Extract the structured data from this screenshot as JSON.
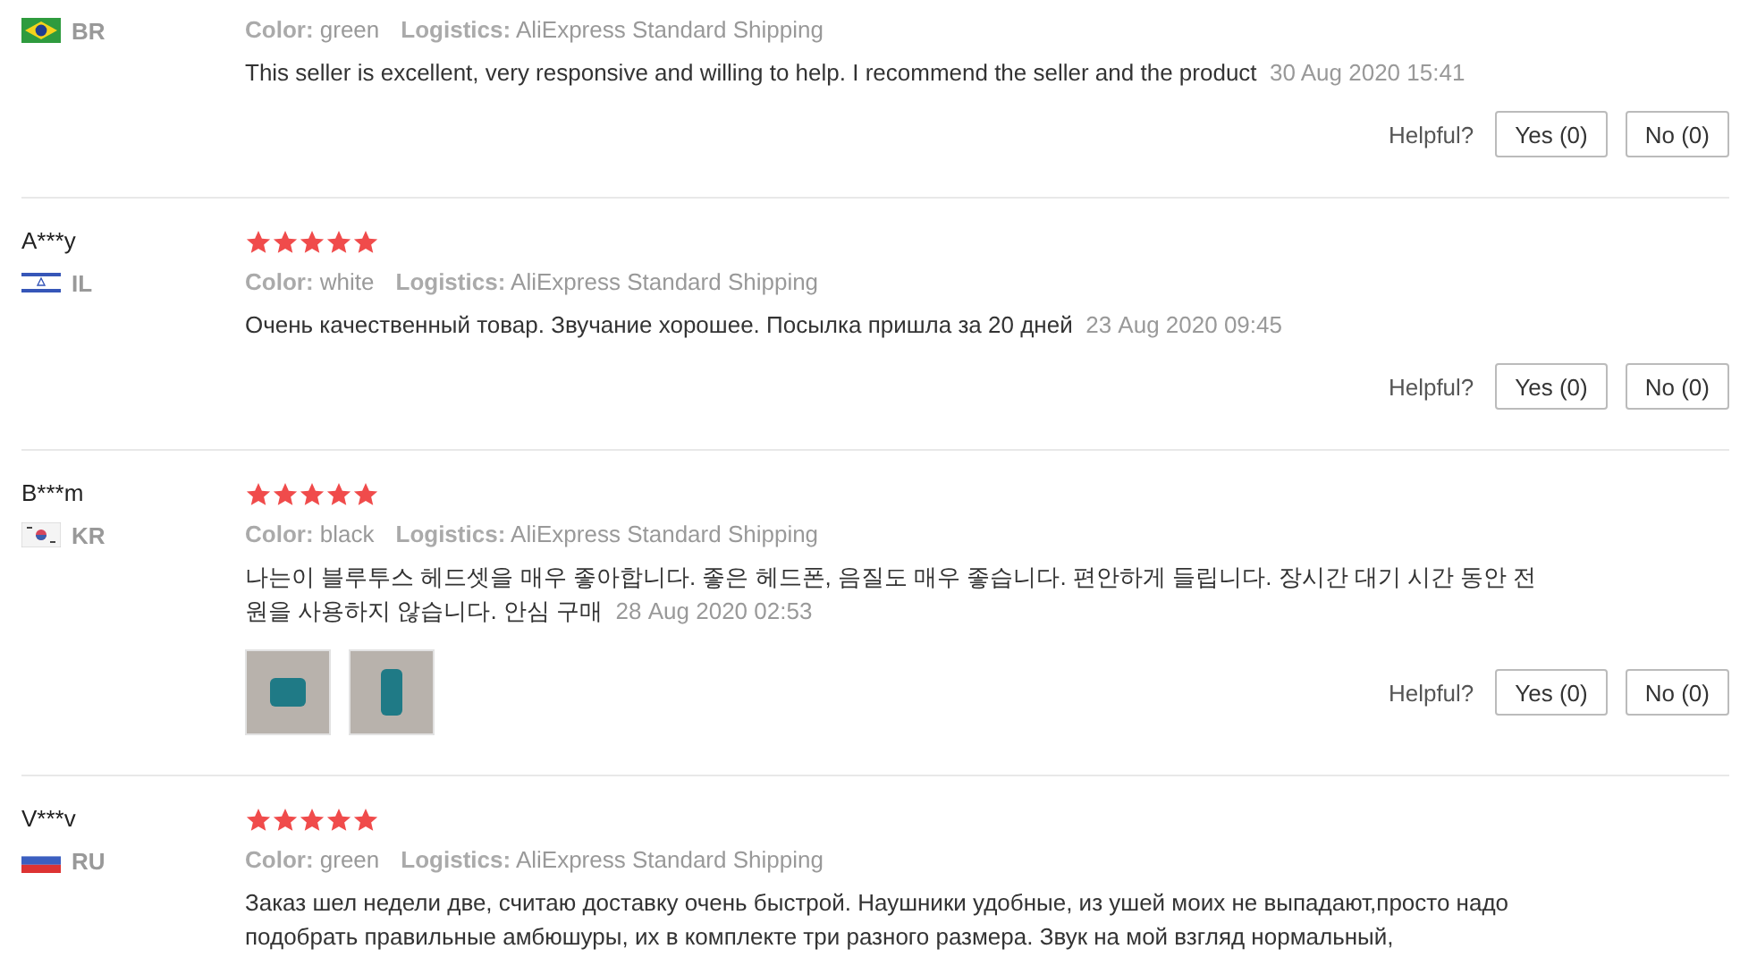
{
  "reviews": [
    {
      "kind": "brazil",
      "country": "BR",
      "color_label": "Color:",
      "color_value": "green",
      "logistics_label": "Logistics:",
      "logistics": "AliExpress Standard Shipping",
      "text": "This seller is excellent, very responsive and willing to help. I recommend the seller and the product",
      "date": "30 Aug 2020 15:41",
      "helpful_label": "Helpful?",
      "yes": "Yes (0)",
      "no": "No (0)"
    },
    {
      "name": "A***y",
      "kind": "israel",
      "country": "IL",
      "stars": 5,
      "color_label": "Color:",
      "color_value": "white",
      "logistics_label": "Logistics:",
      "logistics": "AliExpress Standard Shipping",
      "text": "Очень качественный товар. Звучание хорошее. Посылка пришла за 20 дней",
      "date": "23 Aug 2020 09:45",
      "helpful_label": "Helpful?",
      "yes": "Yes (0)",
      "no": "No (0)"
    },
    {
      "name": "B***m",
      "kind": "korea",
      "country": "KR",
      "stars": 5,
      "color_label": "Color:",
      "color_value": "black",
      "logistics_label": "Logistics:",
      "logistics": "AliExpress Standard Shipping",
      "text": "나는이 블루투스 헤드셋을 매우 좋아합니다. 좋은 헤드폰, 음질도 매우 좋습니다. 편안하게 들립니다. 장시간 대기 시간 동안 전원을 사용하지 않습니다. 안심 구매",
      "date": "28 Aug 2020 02:53",
      "photos": [
        {
          "kind": "square"
        },
        {
          "kind": "tall"
        }
      ],
      "helpful_label": "Helpful?",
      "yes": "Yes (0)",
      "no": "No (0)"
    },
    {
      "name": "V***v",
      "kind": "russia",
      "country": "RU",
      "stars": 5,
      "color_label": "Color:",
      "color_value": "green",
      "logistics_label": "Logistics:",
      "logistics": "AliExpress Standard Shipping",
      "text": "Заказ шел недели две, считаю доставку очень быстрой. Наушники удобные, из ушей моих не выпадают,просто надо подобрать правильные амбюшуры, их в комплекте три разного размера. Звук на мой взгляд нормальный,"
    }
  ]
}
